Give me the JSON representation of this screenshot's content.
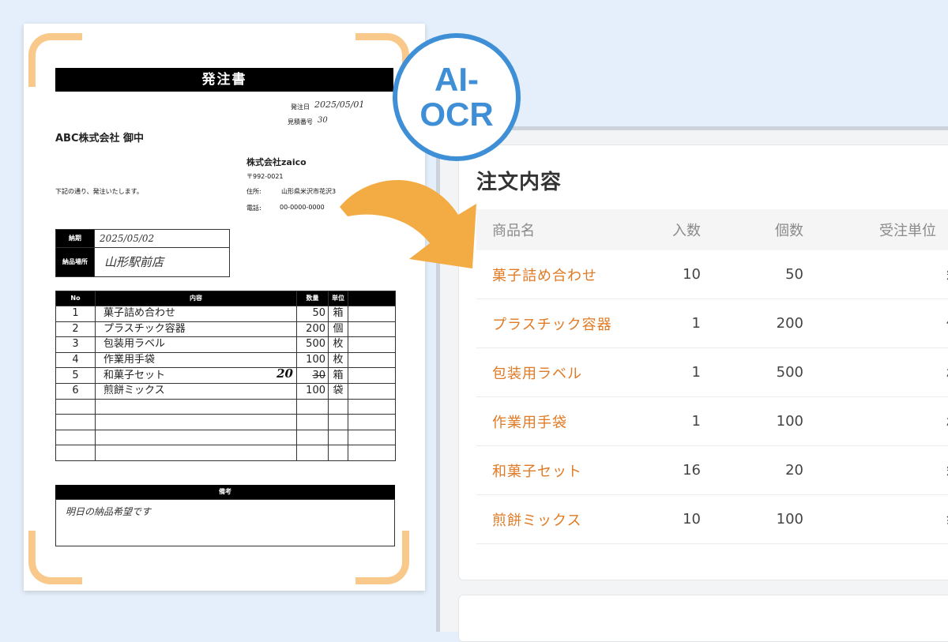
{
  "badge": {
    "line1": "AI-",
    "line2": "OCR"
  },
  "document": {
    "title": "発注書",
    "order_date_label": "発注日",
    "order_date": "2025/05/01",
    "estimate_label": "見積番号",
    "estimate_no": "30",
    "recipient": "ABC株式会社 御中",
    "sender_company": "株式会社zaico",
    "postal": "〒992-0021",
    "address_label": "住所:",
    "address": "山形県米沢市花沢3",
    "phone_label": "電話:",
    "phone": "00-0000-0000",
    "intro": "下記の通り、発注いたします。",
    "delivery_due_label": "納期",
    "delivery_due": "2025/05/02",
    "delivery_place_label": "納品場所",
    "delivery_place": "山形駅前店",
    "table_headers": {
      "no": "No",
      "content": "内容",
      "qty": "数量",
      "unit": "単位"
    },
    "items": [
      {
        "no": "1",
        "name": "菓子詰め合わせ",
        "qty": "50",
        "unit": "箱"
      },
      {
        "no": "2",
        "name": "プラスチック容器",
        "qty": "200",
        "unit": "個"
      },
      {
        "no": "3",
        "name": "包装用ラベル",
        "qty": "500",
        "unit": "枚"
      },
      {
        "no": "4",
        "name": "作業用手袋",
        "qty": "100",
        "unit": "枚"
      },
      {
        "no": "5",
        "name": "和菓子セット",
        "qty": "30",
        "qty_corrected": "20",
        "unit": "箱"
      },
      {
        "no": "6",
        "name": "煎餅ミックス",
        "qty": "100",
        "unit": "袋"
      }
    ],
    "remarks_label": "備考",
    "remarks": "明日の納品希望です"
  },
  "order_panel": {
    "title": "注文内容",
    "columns": {
      "name": "商品名",
      "iri": "入数",
      "qty": "個数",
      "unit": "受注単位"
    },
    "rows": [
      {
        "name": "菓子詰め合わせ",
        "iri": "10",
        "qty": "50",
        "unit": "箱"
      },
      {
        "name": "プラスチック容器",
        "iri": "1",
        "qty": "200",
        "unit": "個"
      },
      {
        "name": "包装用ラベル",
        "iri": "1",
        "qty": "500",
        "unit": "枚"
      },
      {
        "name": "作業用手袋",
        "iri": "1",
        "qty": "100",
        "unit": "枚"
      },
      {
        "name": "和菓子セット",
        "iri": "16",
        "qty": "20",
        "unit": "箱"
      },
      {
        "name": "煎餅ミックス",
        "iri": "10",
        "qty": "100",
        "unit": "袋"
      }
    ]
  },
  "colors": {
    "accent": "#e07a24",
    "badge": "#3f8fd6",
    "arrow": "#f3ac43",
    "scan_frame": "#f9c98b"
  }
}
